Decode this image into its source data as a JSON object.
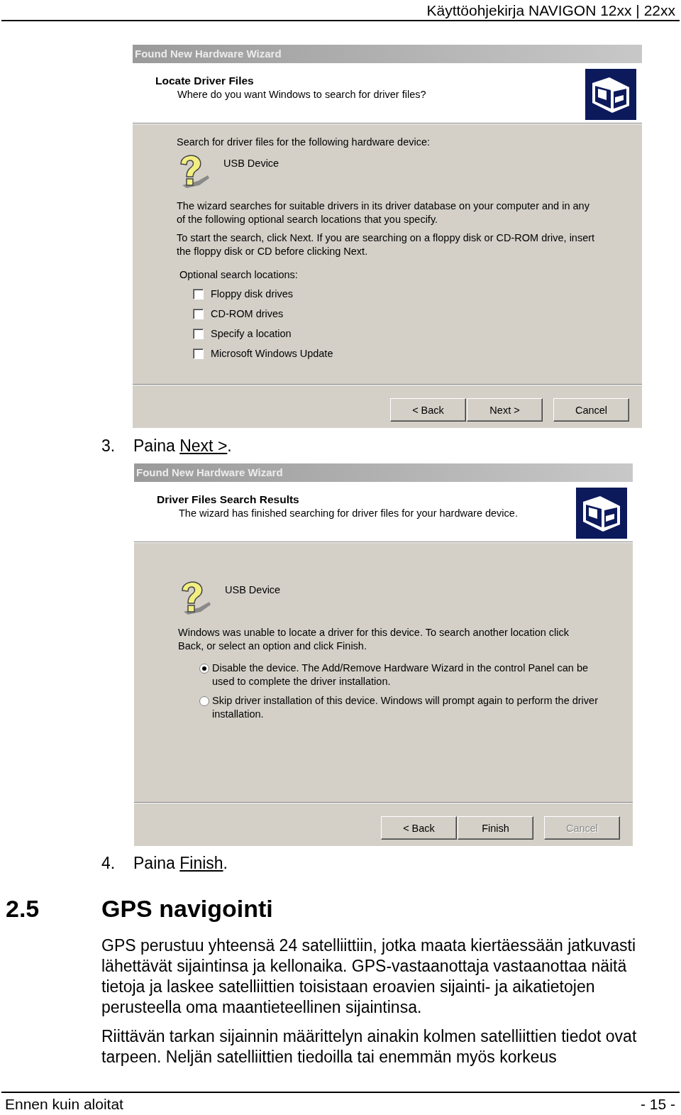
{
  "page_header": {
    "title": "Käyttöohjekirja NAVIGON 12xx | 22xx"
  },
  "content": [
    {
      "kind": "dialog",
      "title": "Found New Hardware Wizard",
      "heading": "Locate Driver Files",
      "subheading": "Where do you want Windows to search for driver files?",
      "body": [
        {
          "kind": "text",
          "text": "Search for driver files for the following hardware device:"
        },
        {
          "kind": "device",
          "text": "USB Device"
        },
        {
          "kind": "text",
          "text": "The wizard searches for suitable drivers in its driver database on your computer and in any of the following optional search locations that you specify."
        },
        {
          "kind": "text",
          "text": "To start the search, click Next. If you are searching on a floppy disk or CD-ROM drive, insert the floppy disk or CD before clicking Next."
        },
        {
          "kind": "group_label",
          "text": "Optional search locations:"
        },
        {
          "kind": "checkbox",
          "text": "Floppy disk drives",
          "checked": false
        },
        {
          "kind": "checkbox",
          "text": "CD-ROM drives",
          "checked": false
        },
        {
          "kind": "checkbox",
          "text": "Specify a location",
          "checked": false
        },
        {
          "kind": "checkbox",
          "text": "Microsoft Windows Update",
          "checked": false
        }
      ],
      "buttons": [
        {
          "label": "< Back",
          "disabled": false
        },
        {
          "label": "Next >",
          "disabled": false
        },
        {
          "label": "Cancel",
          "disabled": false
        }
      ]
    },
    {
      "kind": "step",
      "number": "3.",
      "before": "Paina ",
      "link": "Next >",
      "after": "."
    },
    {
      "kind": "dialog",
      "title": "Found New Hardware Wizard",
      "heading": "Driver Files Search Results",
      "subheading": "The wizard has finished searching for driver files for your hardware device.",
      "body": [
        {
          "kind": "device",
          "text": "USB Device"
        },
        {
          "kind": "text",
          "text": "Windows was unable to locate a driver for this device. To search another location click Back, or select an option and click Finish."
        },
        {
          "kind": "radio",
          "text": "Disable the device. The Add/Remove Hardware Wizard in the control Panel can be used to complete the driver installation.",
          "selected": true
        },
        {
          "kind": "radio",
          "text": "Skip driver installation of this device. Windows will prompt again to perform the driver installation.",
          "selected": false
        }
      ],
      "buttons": [
        {
          "label": "< Back",
          "disabled": false
        },
        {
          "label": "Finish",
          "disabled": false
        },
        {
          "label": "Cancel",
          "disabled": true
        }
      ]
    },
    {
      "kind": "step",
      "number": "4.",
      "before": "Paina ",
      "link": "Finish",
      "after": "."
    },
    {
      "kind": "section_heading",
      "number": "2.5",
      "title": "GPS navigointi"
    },
    {
      "kind": "paragraph",
      "text": "GPS perustuu yhteensä 24 satelliittiin, jotka maata kiertäessään jatkuvasti lähettävät sijaintinsa ja kellonaika. GPS-vastaanottaja vastaanottaa näitä tietoja ja laskee satelliittien toisistaan eroavien sijainti- ja aikatietojen perusteella oma maantieteellinen sijaintinsa."
    },
    {
      "kind": "paragraph",
      "text": "Riittävän tarkan sijainnin määrittelyn ainakin kolmen satelliittien tiedot ovat tarpeen. Neljän satelliittien tiedoilla tai enemmän myös korkeus"
    }
  ],
  "page_footer": {
    "left": "Ennen kuin aloitat",
    "right": "- 15 -"
  }
}
